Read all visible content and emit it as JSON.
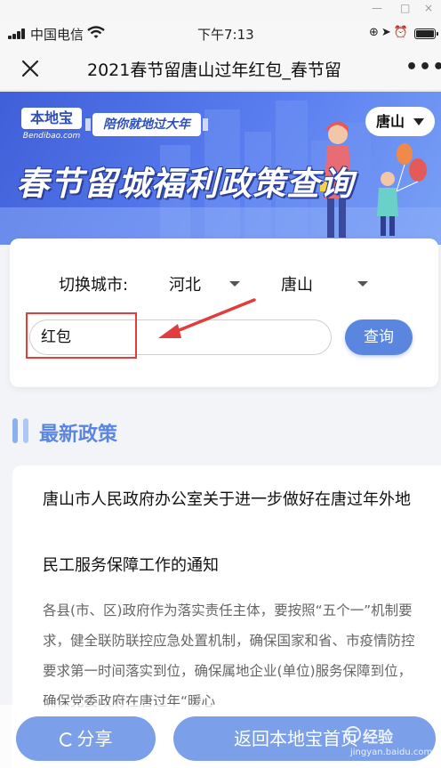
{
  "status": {
    "carrier": "中国电信",
    "time": "下午7:13",
    "icons": [
      "rotation-lock-icon",
      "location-icon",
      "alarm-icon",
      "battery-icon"
    ]
  },
  "nav": {
    "title": "2021春节留唐山过年红包_春节留",
    "close_icon": "close-icon",
    "more_label": "•••"
  },
  "banner": {
    "logo_main": "本地宝",
    "logo_sub": "Bendibao.com",
    "slogan": "陪你就地过大年",
    "title": "春节留城福利政策查询",
    "city": "唐山"
  },
  "query": {
    "switch_label": "切换城市:",
    "province": "河北",
    "city": "唐山",
    "search_value": "红包",
    "search_button": "查询"
  },
  "section": {
    "title": "最新政策"
  },
  "article": {
    "title_line1": "唐山市人民政府办公室关于进一步做好在唐过年外地",
    "title_line2": "民工服务保障工作的通知",
    "body": "各县(市、区)政府作为落实责任主体，要按照“五个一”机制要求，健全联防联控应急处置机制，确保国家和省、市疫情防控要求第一时间落实到位，确保属地企业(单位)服务保障到位，确保党委政府在唐过年“暖心"
  },
  "bottom": {
    "share_label": "分享",
    "home_label": "返回本地宝首页",
    "watermark_main": "经验",
    "watermark_sub": "jingyan.baidu.com"
  },
  "colors": {
    "accent": "#5b86e0",
    "banner_blue": "#4a6be0",
    "highlight_red": "#e23c3c"
  }
}
